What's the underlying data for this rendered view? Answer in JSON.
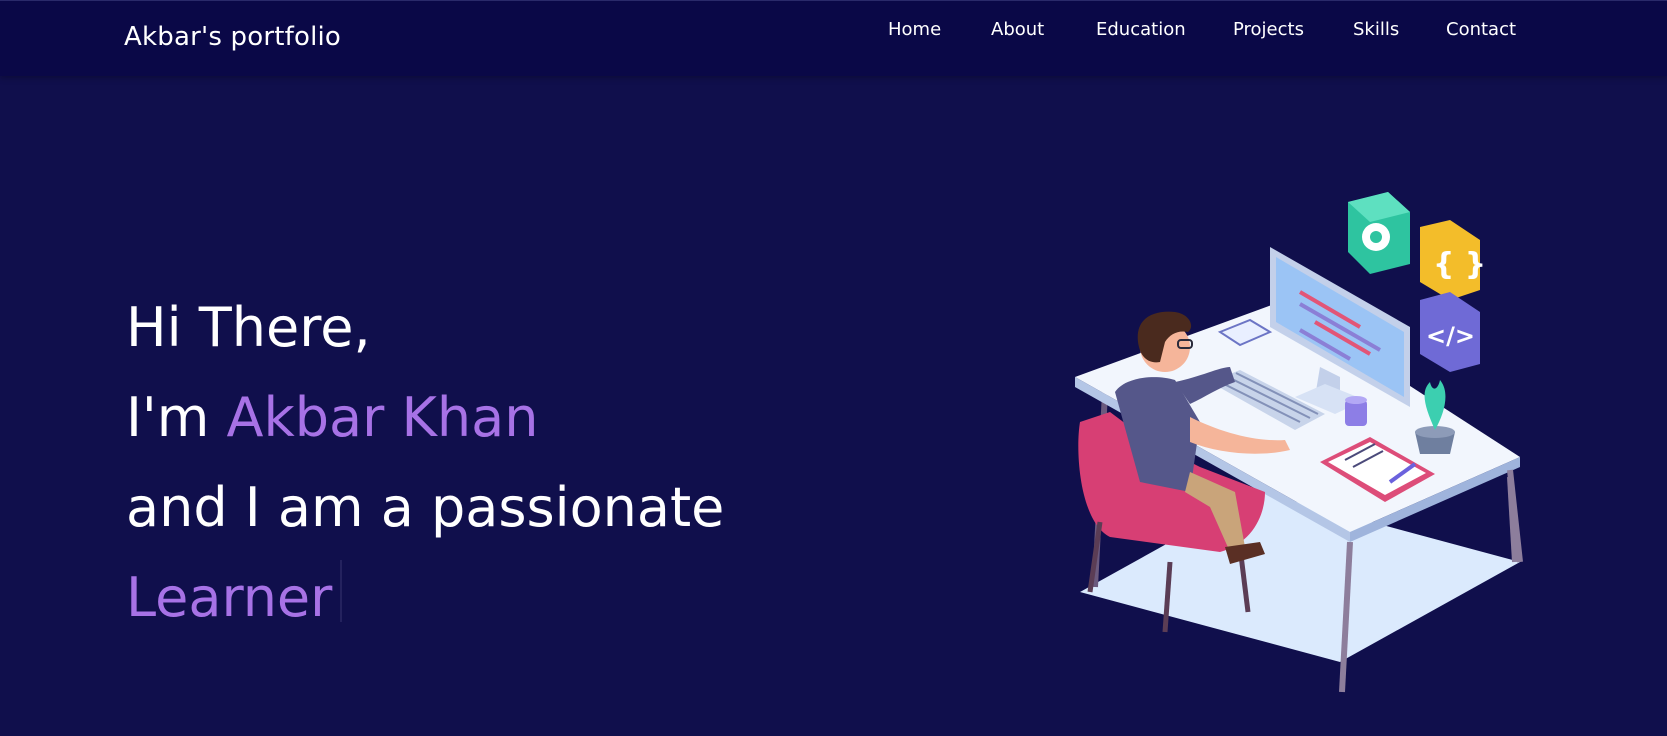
{
  "navbar": {
    "brand": "Akbar's portfolio",
    "links": [
      {
        "label": "Home"
      },
      {
        "label": "About"
      },
      {
        "label": "Education"
      },
      {
        "label": "Projects"
      },
      {
        "label": "Skills"
      },
      {
        "label": "Contact"
      }
    ]
  },
  "hero": {
    "greeting": "Hi There,",
    "intro_prefix": "I'm ",
    "name": "Akbar Khan",
    "tagline": "and I am a passionate",
    "typed_role": "Learner"
  },
  "colors": {
    "background": "#100f4c",
    "navbar": "#0a0847",
    "accent": "#a772e6",
    "text": "#ffffff"
  },
  "illustration": {
    "icons": [
      "gear-icon",
      "curly-braces-icon",
      "code-tag-icon"
    ]
  }
}
